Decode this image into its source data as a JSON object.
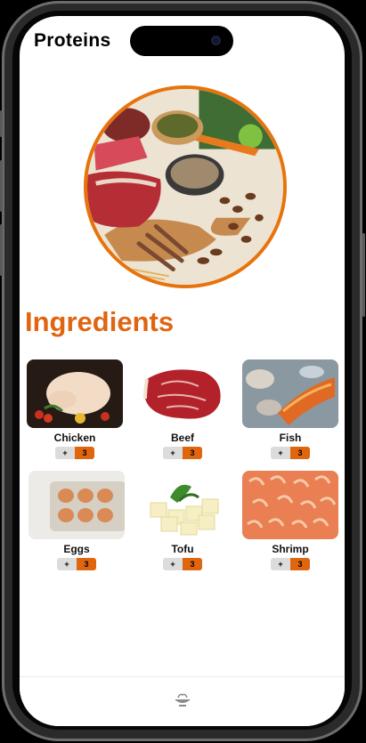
{
  "app": {
    "title": "Proteins"
  },
  "hero": {
    "image": "mixed protein foods platter"
  },
  "section": {
    "title": "Ingredients"
  },
  "ingredients": [
    {
      "name": "Chicken",
      "image": "raw whole chicken",
      "add_label": "+",
      "quantity": "3"
    },
    {
      "name": "Beef",
      "image": "beef steak",
      "add_label": "+",
      "quantity": "3"
    },
    {
      "name": "Fish",
      "image": "fish and seafood",
      "add_label": "+",
      "quantity": "3"
    },
    {
      "name": "Eggs",
      "image": "egg carton",
      "add_label": "+",
      "quantity": "3"
    },
    {
      "name": "Tofu",
      "image": "tofu cubes",
      "add_label": "+",
      "quantity": "3"
    },
    {
      "name": "Shrimp",
      "image": "shrimp pile",
      "add_label": "+",
      "quantity": "3"
    }
  ],
  "tab_bar": {
    "active_icon": "food-bowl-icon"
  },
  "colors": {
    "accent": "#e06512",
    "stepper_grey": "#dcdcdc"
  }
}
